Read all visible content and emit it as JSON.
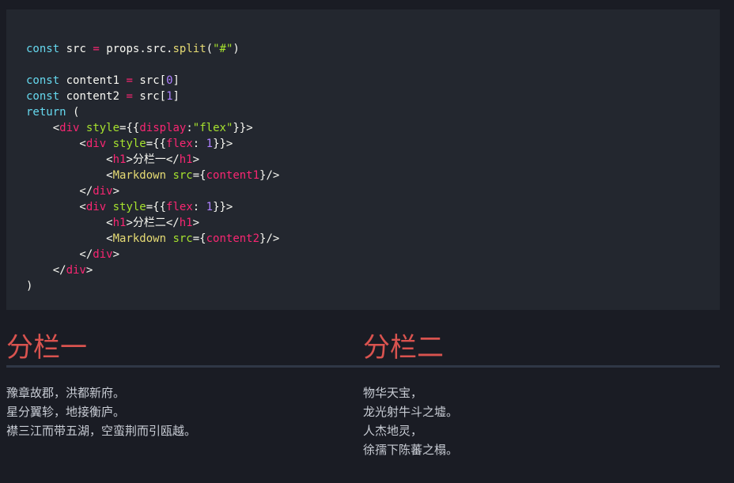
{
  "code": {
    "lines": [
      "const src = props.src.split(\"#\")",
      "",
      "const content1 = src[0]",
      "const content2 = src[1]",
      "return (",
      "    <div style={{display:\"flex\"}}>",
      "        <div style={{flex: 1}}>",
      "            <h1>分栏一</h1>",
      "            <Markdown src={content1}/>",
      "        </div>",
      "        <div style={{flex: 1}}>",
      "            <h1>分栏二</h1>",
      "            <Markdown src={content2}/>",
      "        </div>",
      "    </div>",
      ")"
    ]
  },
  "columns": [
    {
      "title": "分栏一",
      "lines": [
        "豫章故郡，洪都新府。",
        "星分翼轸，地接衡庐。",
        "襟三江而带五湖，空蛮荆而引瓯越。"
      ]
    },
    {
      "title": "分栏二",
      "lines": [
        "物华天宝，",
        "龙光射牛斗之墟。",
        "人杰地灵，",
        "徐孺下陈蕃之榻。"
      ]
    }
  ],
  "colors": {
    "background": "#1a1c24",
    "code_background": "#23272f",
    "heading": "#d9534f",
    "divider": "#2f3746",
    "body_text": "#c8ccd4"
  }
}
